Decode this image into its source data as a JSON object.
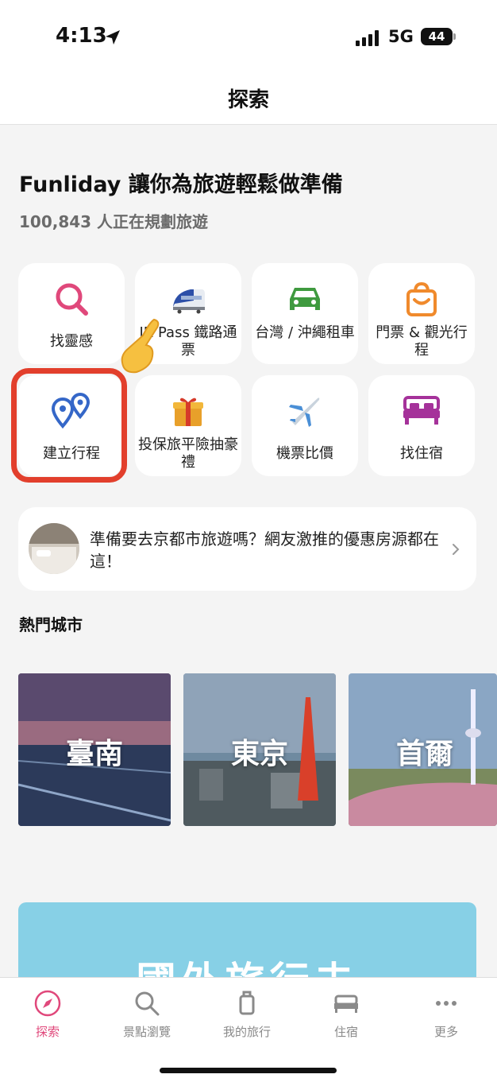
{
  "status_bar": {
    "time": "4:13",
    "network": "5G",
    "battery": "44"
  },
  "header": {
    "title": "探索"
  },
  "hero": {
    "headline": "Funliday 讓你為旅遊輕鬆做準備",
    "subhead": "100,843 人正在規劃旅遊"
  },
  "tiles": [
    {
      "label": "找靈感",
      "icon": "search-icon"
    },
    {
      "label": "JR Pass 鐵路通票",
      "icon": "bullet-train-icon"
    },
    {
      "label": "台灣 / 沖繩租車",
      "icon": "car-icon"
    },
    {
      "label": "門票 & 觀光行程",
      "icon": "shopping-bag-icon"
    },
    {
      "label": "建立行程",
      "icon": "map-pins-icon"
    },
    {
      "label": "投保旅平險抽豪禮",
      "icon": "gift-icon"
    },
    {
      "label": "機票比價",
      "icon": "airplane-icon"
    },
    {
      "label": "找住宿",
      "icon": "bed-icon"
    }
  ],
  "promo": {
    "text": "準備要去京都市旅遊嗎？網友激推的優惠房源都在這！"
  },
  "popular_cities": {
    "title": "熱門城市",
    "cities": [
      {
        "name": "臺南"
      },
      {
        "name": "東京"
      },
      {
        "name": "首爾"
      }
    ]
  },
  "banner": {
    "text": "國外旅行去"
  },
  "tabbar": {
    "items": [
      {
        "label": "探索",
        "icon": "compass-icon",
        "active": true
      },
      {
        "label": "景點瀏覽",
        "icon": "search-icon"
      },
      {
        "label": "我的旅行",
        "icon": "luggage-icon"
      },
      {
        "label": "住宿",
        "icon": "bed-icon"
      },
      {
        "label": "更多",
        "icon": "more-dots-icon"
      }
    ]
  },
  "colors": {
    "accent": "#e0487b",
    "highlight": "#e23f2c",
    "inactive": "#8a8a8a"
  }
}
